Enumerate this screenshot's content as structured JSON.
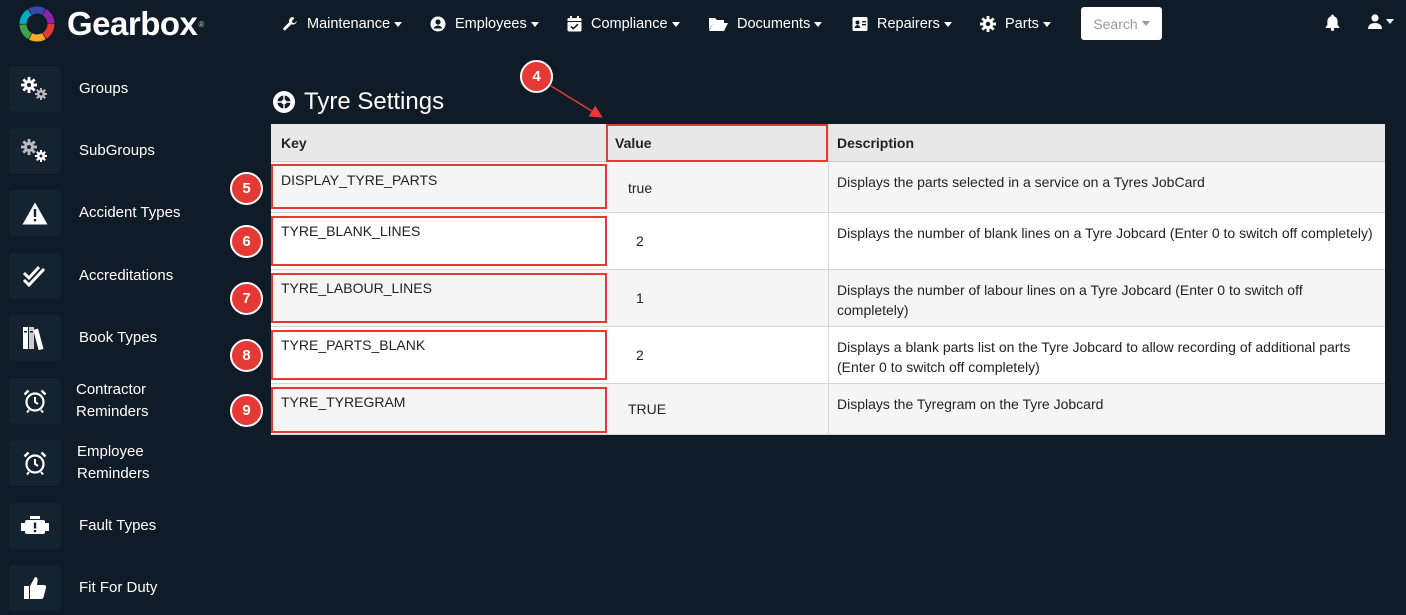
{
  "app": {
    "name": "Gearbox",
    "tm": "®"
  },
  "nav": {
    "items": [
      {
        "label": "Maintenance",
        "icon": "wrench-icon"
      },
      {
        "label": "Employees",
        "icon": "user-circle-icon"
      },
      {
        "label": "Compliance",
        "icon": "calendar-check-icon"
      },
      {
        "label": "Documents",
        "icon": "folder-open-icon"
      },
      {
        "label": "Repairers",
        "icon": "id-card-icon"
      },
      {
        "label": "Parts",
        "icon": "gear-icon"
      }
    ],
    "search_label": "Search"
  },
  "sidebar": {
    "items": [
      {
        "label": "Groups",
        "icon": "gears-icon"
      },
      {
        "label": "SubGroups",
        "icon": "gears-icon"
      },
      {
        "label": "Accident Types",
        "icon": "warning-icon"
      },
      {
        "label": "Accreditations",
        "icon": "double-check-icon"
      },
      {
        "label": "Book Types",
        "icon": "books-icon"
      },
      {
        "label": "Contractor\nReminders",
        "icon": "alarm-clock-icon"
      },
      {
        "label": "Employee\nReminders",
        "icon": "alarm-clock-icon"
      },
      {
        "label": "Fault Types",
        "icon": "engine-warning-icon"
      },
      {
        "label": "Fit For Duty",
        "icon": "thumbs-up-icon"
      }
    ]
  },
  "page": {
    "title": "Tyre Settings"
  },
  "table": {
    "headers": {
      "key": "Key",
      "value": "Value",
      "description": "Description"
    },
    "rows": [
      {
        "key": "DISPLAY_TYRE_PARTS",
        "value": "true",
        "description": "Displays the parts selected in a service on a Tyres JobCard"
      },
      {
        "key": "TYRE_BLANK_LINES",
        "value": "2",
        "description": "Displays the number of blank lines on a Tyre Jobcard (Enter 0 to switch off completely)"
      },
      {
        "key": "TYRE_LABOUR_LINES",
        "value": "1",
        "description": "Displays the number of labour lines on a Tyre Jobcard (Enter 0 to switch off completely)"
      },
      {
        "key": "TYRE_PARTS_BLANK",
        "value": "2",
        "description": "Displays a blank parts list on the Tyre Jobcard to allow recording of additional parts (Enter 0 to switch off completely)"
      },
      {
        "key": "TYRE_TYREGRAM",
        "value": "TRUE",
        "description": "Displays the Tyregram on the Tyre Jobcard"
      }
    ]
  },
  "annotations": {
    "badges": [
      "4",
      "5",
      "6",
      "7",
      "8",
      "9"
    ],
    "color": "#e53935"
  }
}
